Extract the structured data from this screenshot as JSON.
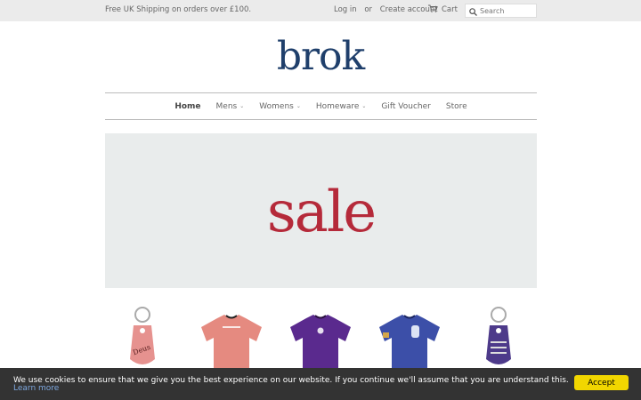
{
  "topbar": {
    "shipping": "Free UK Shipping on orders over £100.",
    "login": "Log in",
    "or": "or",
    "create_account": "Create account",
    "cart": "Cart",
    "search_placeholder": "Search"
  },
  "logo": "brok",
  "nav": {
    "items": [
      {
        "label": "Home"
      },
      {
        "label": "Mens"
      },
      {
        "label": "Womens"
      },
      {
        "label": "Homeware"
      },
      {
        "label": "Gift Voucher"
      },
      {
        "label": "Store"
      }
    ]
  },
  "banner": {
    "text": "sale"
  },
  "products": [
    {
      "name": "pink-keyring",
      "color": "#e6928f"
    },
    {
      "name": "pink-tshirt",
      "color": "#e58a80"
    },
    {
      "name": "purple-tshirt",
      "color": "#5a2a8e"
    },
    {
      "name": "blue-tshirt",
      "color": "#3c4fa8"
    },
    {
      "name": "purple-keyring",
      "color": "#4d3a8a"
    }
  ],
  "cookie": {
    "message": "We use cookies to ensure that we give you the best experience on our website. If you continue we'll assume that you are understand this. ",
    "learn_more": "Learn more",
    "accept": "Accept"
  },
  "colors": {
    "brand": "#1f3f6b",
    "sale": "#b52a3a",
    "accept_button": "#f1d600",
    "cookie_bar": "#333333"
  }
}
